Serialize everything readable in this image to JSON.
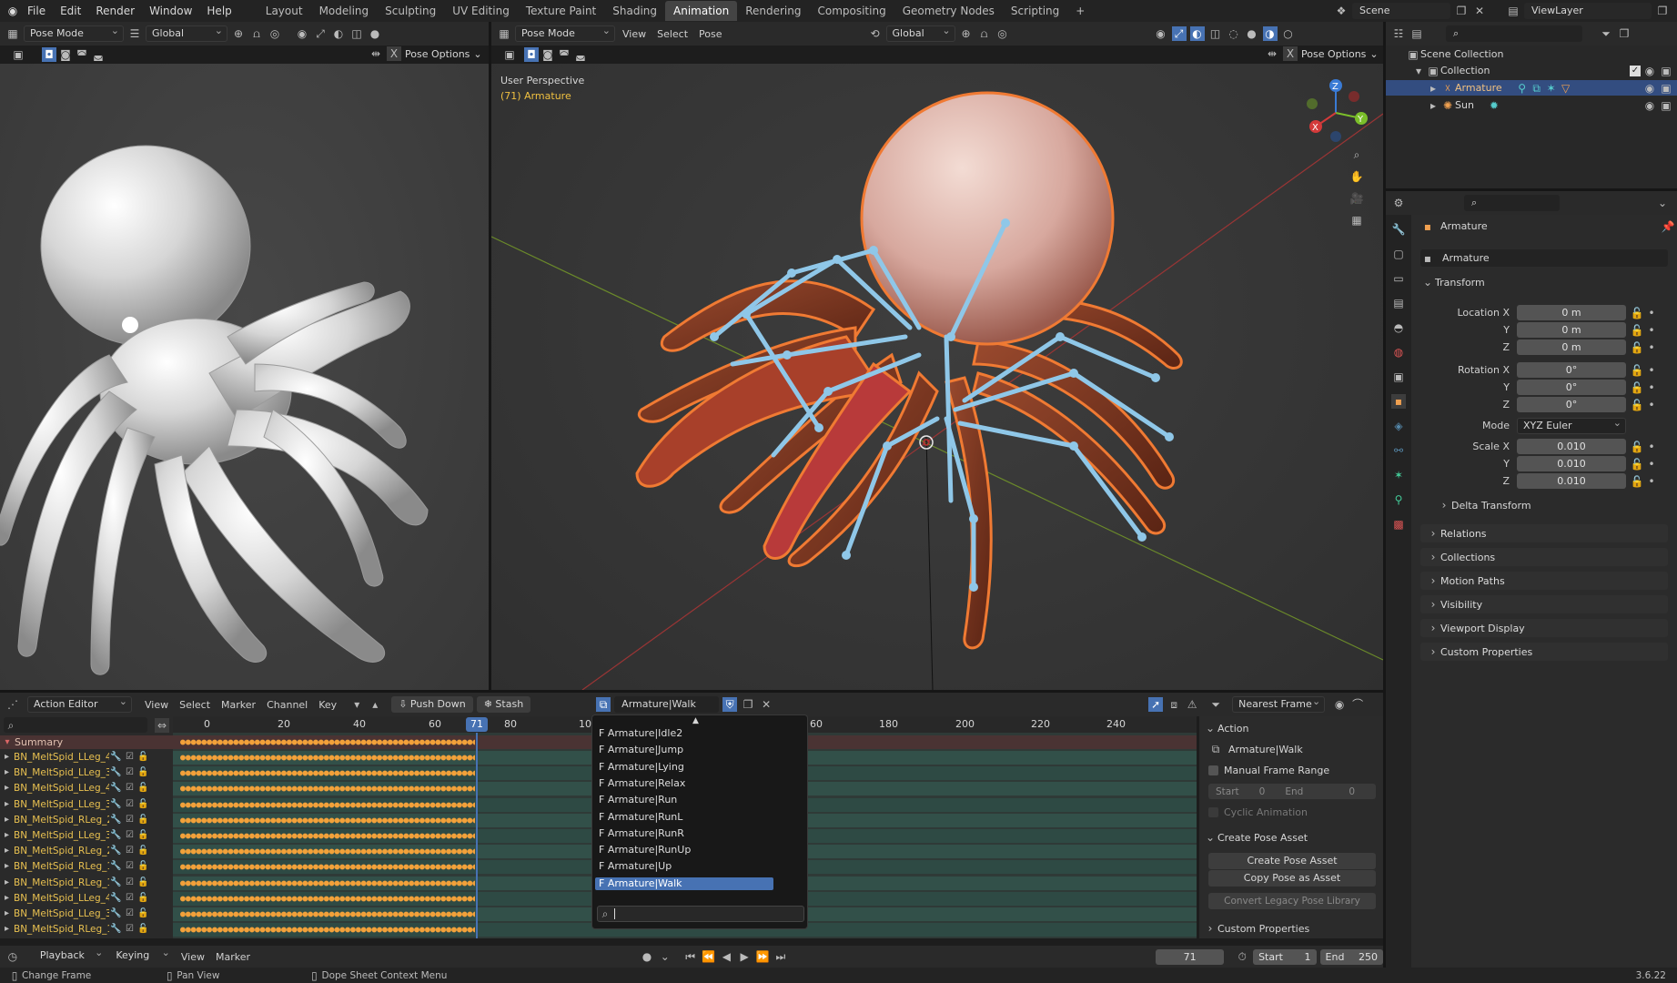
{
  "menubar": {
    "items": [
      "File",
      "Edit",
      "Render",
      "Window",
      "Help"
    ],
    "workspaces": [
      "Layout",
      "Modeling",
      "Sculpting",
      "UV Editing",
      "Texture Paint",
      "Shading",
      "Animation",
      "Rendering",
      "Compositing",
      "Geometry Nodes",
      "Scripting"
    ],
    "active_workspace": "Animation",
    "add_tab": "+",
    "scene": "Scene",
    "view_layer": "ViewLayer"
  },
  "left_viewport": {
    "mode": "Pose Mode",
    "orientation": "Global",
    "pose_options": "Pose Options"
  },
  "main_viewport": {
    "mode": "Pose Mode",
    "menus": [
      "View",
      "Select",
      "Pose"
    ],
    "orientation": "Global",
    "pose_options": "Pose Options",
    "perspective_label": "User Perspective",
    "object_label": "(71) Armature",
    "gizmo_axes": {
      "x": "X",
      "y": "Y",
      "z": "Z"
    }
  },
  "outliner": {
    "root": "Scene Collection",
    "collection": "Collection",
    "items": [
      "Armature",
      "Sun"
    ]
  },
  "properties": {
    "object_name": "Armature",
    "data_name": "Armature",
    "transform_title": "Transform",
    "location": {
      "label_x": "Location X",
      "label_y": "Y",
      "label_z": "Z",
      "x": "0 m",
      "y": "0 m",
      "z": "0 m"
    },
    "rotation": {
      "label_x": "Rotation X",
      "label_y": "Y",
      "label_z": "Z",
      "x": "0°",
      "y": "0°",
      "z": "0°"
    },
    "mode_label": "Mode",
    "mode_value": "XYZ Euler",
    "scale": {
      "label_x": "Scale X",
      "label_y": "Y",
      "label_z": "Z",
      "x": "0.010",
      "y": "0.010",
      "z": "0.010"
    },
    "delta_transform": "Delta Transform",
    "sections": [
      "Relations",
      "Collections",
      "Motion Paths",
      "Visibility",
      "Viewport Display",
      "Custom Properties"
    ]
  },
  "action_editor": {
    "editor_type": "Action Editor",
    "menus": [
      "View",
      "Select",
      "Marker",
      "Channel",
      "Key"
    ],
    "push_down": "Push Down",
    "stash": "Stash",
    "action": "Armature|Walk",
    "snap": "Nearest Frame",
    "ruler": [
      "0",
      "20",
      "40",
      "60",
      "80",
      "10",
      "60",
      "180",
      "200",
      "220",
      "240"
    ],
    "current_frame": "71",
    "summary": "Summary",
    "channels": [
      "BN_MeltSpid_LLeg_4_(",
      "BN_MeltSpid_LLeg_3_(",
      "BN_MeltSpid_LLeg_4_(",
      "BN_MeltSpid_LLeg_3_(",
      "BN_MeltSpid_RLeg_2_(",
      "BN_MeltSpid_LLeg_3_(",
      "BN_MeltSpid_RLeg_2_(",
      "BN_MeltSpid_RLeg_1_(",
      "BN_MeltSpid_RLeg_1_(",
      "BN_MeltSpid_LLeg_4_(",
      "BN_MeltSpid_LLeg_3_(",
      "BN_MeltSpid_RLeg_1_("
    ],
    "dropdown_options": [
      "F Armature|Idle2",
      "F Armature|Jump",
      "F Armature|Lying",
      "F Armature|Relax",
      "F Armature|Run",
      "F Armature|RunL",
      "F Armature|RunR",
      "F Armature|RunUp",
      "F Armature|Up",
      "F Armature|Walk"
    ],
    "dropdown_selected": "F Armature|Walk",
    "side_panel": {
      "action_title": "Action",
      "action_name": "Armature|Walk",
      "manual_range": "Manual Frame Range",
      "start_label": "Start",
      "start_value": "0",
      "end_label": "End",
      "end_value": "0",
      "cyclic": "Cyclic Animation",
      "pose_asset_title": "Create Pose Asset",
      "create_pose_asset": "Create Pose Asset",
      "copy_pose_asset": "Copy Pose as Asset",
      "convert_legacy": "Convert Legacy Pose Library",
      "custom_props": "Custom Properties"
    }
  },
  "timeline": {
    "menus": [
      "Playback",
      "Keying",
      "View",
      "Marker"
    ],
    "frame": "71",
    "start_label": "Start",
    "start": "1",
    "end_label": "End",
    "end": "250"
  },
  "statusbar": {
    "change_frame": "Change Frame",
    "pan_view": "Pan View",
    "context_menu": "Dope Sheet Context Menu",
    "version": "3.6.22"
  },
  "colors": {
    "accent": "#4772b3",
    "keyframe": "#f2a13a",
    "bone": "#8fc7e8",
    "selection": "#f07a33"
  }
}
